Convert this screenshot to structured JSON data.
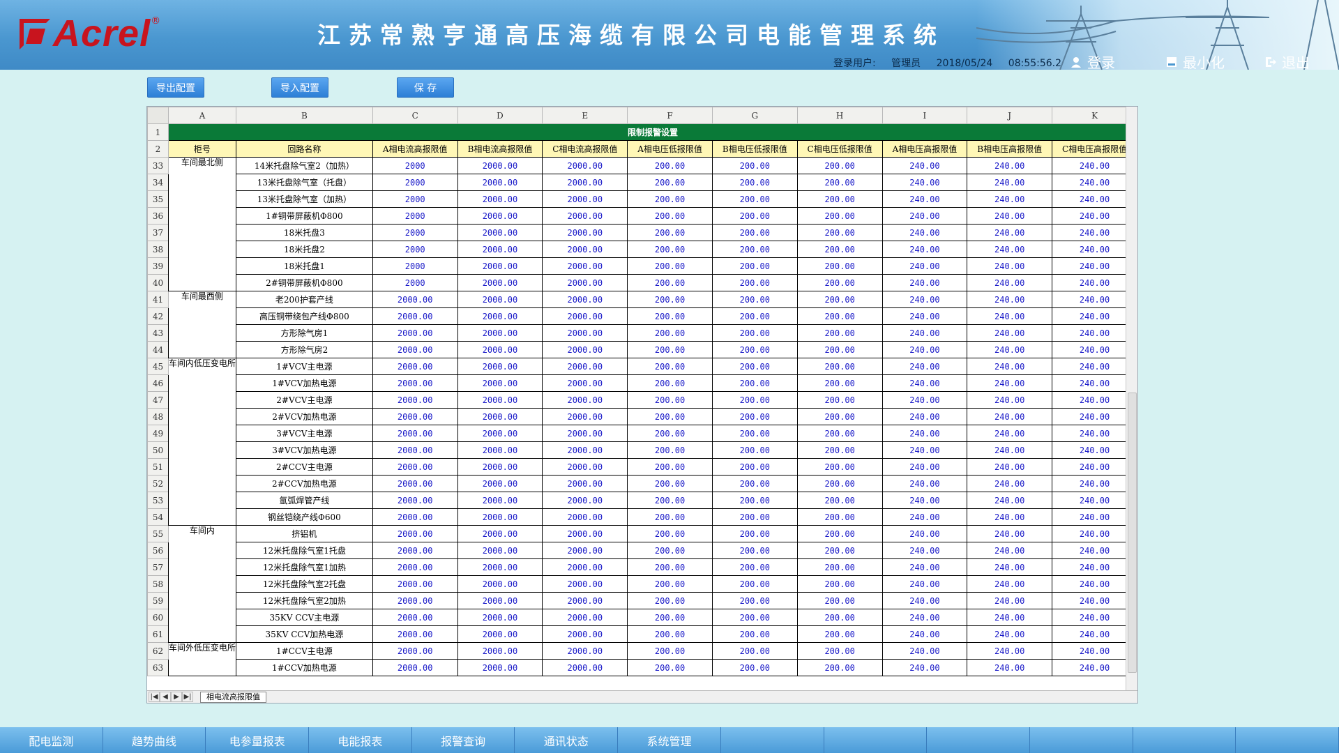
{
  "header": {
    "logo_text": "Acrel",
    "logo_reg": "®",
    "title": "江苏常熟亨通高压海缆有限公司电能管理系统",
    "user_label": "登录用户:",
    "user_name": "管理员",
    "date": "2018/05/24",
    "time": "08:55:56.2",
    "login_label": "登录",
    "minimize_label": "最小化",
    "exit_label": "退出"
  },
  "toolbar": {
    "export_label": "导出配置",
    "import_label": "导入配置",
    "save_label": "保 存"
  },
  "sheet": {
    "columns": [
      "A",
      "B",
      "C",
      "D",
      "E",
      "F",
      "G",
      "H",
      "I",
      "J",
      "K"
    ],
    "title": "限制报警设置",
    "headers": [
      "柜号",
      "回路名称",
      "A相电流高报限值",
      "B相电流高报限值",
      "C相电流高报限值",
      "A相电压低报限值",
      "B相电压低报限值",
      "C相电压低报限值",
      "A相电压高报限值",
      "B相电压高报限值",
      "C相电压高报限值"
    ],
    "groups": [
      {
        "label": "车间最北侧",
        "start": 33,
        "span": 8
      },
      {
        "label": "车间最西侧",
        "start": 41,
        "span": 4
      },
      {
        "label": "车间内低压变电所",
        "start": 45,
        "span": 10
      },
      {
        "label": "车间内",
        "start": 55,
        "span": 7
      },
      {
        "label": "车间外低压变电所",
        "start": 62,
        "span": 2
      }
    ],
    "rows": [
      {
        "n": "33",
        "name": "14米托盘除气室2（加热）",
        "a": "2000"
      },
      {
        "n": "34",
        "name": "13米托盘除气室（托盘）",
        "a": "2000"
      },
      {
        "n": "35",
        "name": "13米托盘除气室（加热）",
        "a": "2000"
      },
      {
        "n": "36",
        "name": "1#铜带屏蔽机Φ800",
        "a": "2000"
      },
      {
        "n": "37",
        "name": "18米托盘3",
        "a": "2000"
      },
      {
        "n": "38",
        "name": "18米托盘2",
        "a": "2000"
      },
      {
        "n": "39",
        "name": "18米托盘1",
        "a": "2000"
      },
      {
        "n": "40",
        "name": "2#铜带屏蔽机Φ800",
        "a": "2000"
      },
      {
        "n": "41",
        "name": "老200护套产线",
        "a": "2000.00"
      },
      {
        "n": "42",
        "name": "高压铜带绕包产线Φ800",
        "a": "2000.00"
      },
      {
        "n": "43",
        "name": "方形除气房1",
        "a": "2000.00"
      },
      {
        "n": "44",
        "name": "方形除气房2",
        "a": "2000.00"
      },
      {
        "n": "45",
        "name": "1#VCV主电源",
        "a": "2000.00"
      },
      {
        "n": "46",
        "name": "1#VCV加热电源",
        "a": "2000.00"
      },
      {
        "n": "47",
        "name": "2#VCV主电源",
        "a": "2000.00"
      },
      {
        "n": "48",
        "name": "2#VCV加热电源",
        "a": "2000.00"
      },
      {
        "n": "49",
        "name": "3#VCV主电源",
        "a": "2000.00"
      },
      {
        "n": "50",
        "name": "3#VCV加热电源",
        "a": "2000.00"
      },
      {
        "n": "51",
        "name": "2#CCV主电源",
        "a": "2000.00"
      },
      {
        "n": "52",
        "name": "2#CCV加热电源",
        "a": "2000.00"
      },
      {
        "n": "53",
        "name": "氩弧焊管产线",
        "a": "2000.00"
      },
      {
        "n": "54",
        "name": "钢丝铠绕产线Φ600",
        "a": "2000.00"
      },
      {
        "n": "55",
        "name": "挤铝机",
        "a": "2000.00"
      },
      {
        "n": "56",
        "name": "12米托盘除气室1托盘",
        "a": "2000.00"
      },
      {
        "n": "57",
        "name": "12米托盘除气室1加热",
        "a": "2000.00"
      },
      {
        "n": "58",
        "name": "12米托盘除气室2托盘",
        "a": "2000.00"
      },
      {
        "n": "59",
        "name": "12米托盘除气室2加热",
        "a": "2000.00"
      },
      {
        "n": "60",
        "name": "35KV CCV主电源",
        "a": "2000.00"
      },
      {
        "n": "61",
        "name": "35KV CCV加热电源",
        "a": "2000.00"
      },
      {
        "n": "62",
        "name": "1#CCV主电源",
        "a": "2000.00"
      },
      {
        "n": "63",
        "name": "1#CCV加热电源",
        "a": "2000.00"
      }
    ],
    "fixed_values": {
      "b": "2000.00",
      "c": "2000.00",
      "d": "200.00",
      "e": "200.00",
      "f": "200.00",
      "g": "240.00",
      "h": "240.00",
      "i": "240.00"
    },
    "tab_label": "相电流高报限值"
  },
  "nav": [
    "配电监测",
    "趋势曲线",
    "电参量报表",
    "电能报表",
    "报警查询",
    "通讯状态",
    "系统管理",
    "",
    "",
    "",
    "",
    "",
    ""
  ]
}
